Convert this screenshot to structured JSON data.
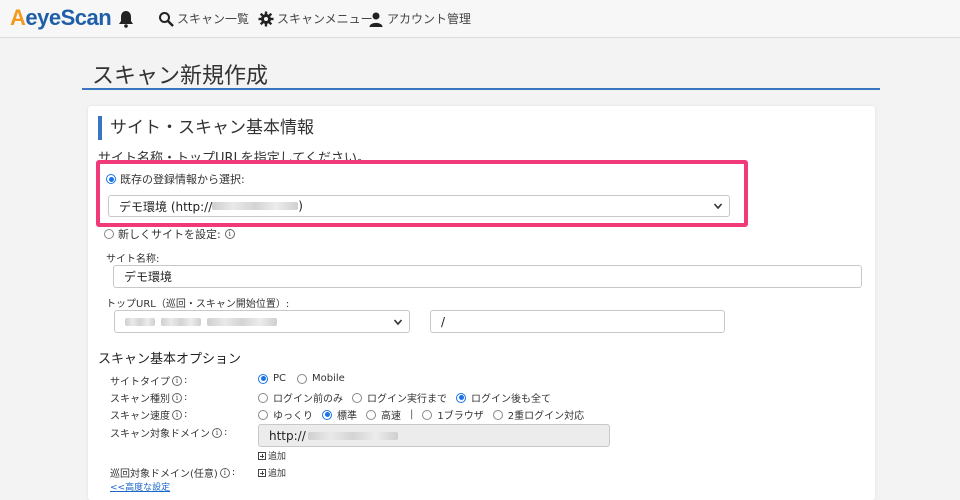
{
  "nav": {
    "logo_a": "A",
    "logo_rest": "eyeScan",
    "items": [
      {
        "label": "スキャン一覧"
      },
      {
        "label": "スキャンメニュー"
      },
      {
        "label": "アカウント管理"
      }
    ]
  },
  "page": {
    "title": "スキャン新規作成"
  },
  "section": {
    "title": "サイト・スキャン基本情報",
    "instruction": "サイト名称・トップURLを指定してください。",
    "existing_label": "既存の登録情報から選択:",
    "existing_selected_prefix": "デモ環境 (http://",
    "existing_selected_suffix": ")",
    "new_label": "新しくサイトを設定:",
    "site_name_label": "サイト名称:",
    "site_name_value": "デモ環境",
    "top_url_label": "トップURL（巡回・スキャン開始位置）:",
    "top_url_path": "/"
  },
  "options": {
    "heading": "スキャン基本オプション",
    "site_type": {
      "label": "サイトタイプ",
      "colon": ":",
      "opts": [
        "PC",
        "Mobile"
      ],
      "selected": "PC"
    },
    "scan_kind": {
      "label": "スキャン種別",
      "colon": ":",
      "opts": [
        "ログイン前のみ",
        "ログイン実行まで",
        "ログイン後も全て"
      ],
      "selected": "ログイン後も全て"
    },
    "scan_speed": {
      "label": "スキャン速度",
      "colon": ":",
      "opts": [
        "ゆっくり",
        "標準",
        "高速"
      ],
      "separator": "|",
      "opts2": [
        "1ブラウザ",
        "2重ログイン対応"
      ],
      "selected": "標準"
    },
    "target_domain": {
      "label": "スキャン対象ドメイン",
      "colon": ":",
      "value_prefix": "http://",
      "add_label": "追加"
    },
    "crawl_domain": {
      "label": "巡回対象ドメイン(任意)",
      "colon": ":",
      "add_label": "追加"
    },
    "advanced_link": "<<高度な設定"
  },
  "colors": {
    "accent": "#3a76c0",
    "highlight": "#f03a7a",
    "logo_orange": "#f29a1f",
    "logo_blue": "#1f5fa8"
  }
}
